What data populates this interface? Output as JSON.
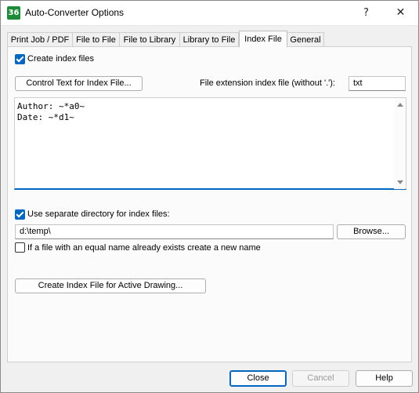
{
  "window": {
    "title": "Auto-Converter Options",
    "app_icon_text": "36",
    "help_glyph": "?",
    "close_glyph": "✕"
  },
  "tabs": [
    {
      "label": "Print Job / PDF",
      "active": false
    },
    {
      "label": "File to File",
      "active": false
    },
    {
      "label": "File to Library",
      "active": false
    },
    {
      "label": "Library to File",
      "active": false
    },
    {
      "label": "Index File",
      "active": true
    },
    {
      "label": "General",
      "active": false
    }
  ],
  "index_file": {
    "create_index_files": {
      "label": "Create index files",
      "checked": true
    },
    "control_text_button": "Control Text for Index File...",
    "extension_label": "File extension index file (without '.'):",
    "extension_value": "txt",
    "index_text": "Author: ~*a0~\nDate: ~*d1~",
    "use_separate_dir": {
      "label": "Use separate directory for index files:",
      "checked": true
    },
    "directory_value": "d:\\temp\\",
    "browse_button": "Browse...",
    "new_name_option": {
      "label": "If a file with an equal name already exists create a new name",
      "checked": false
    },
    "create_active_button": "Create Index File for Active Drawing..."
  },
  "footer": {
    "close": "Close",
    "cancel": "Cancel",
    "help": "Help"
  }
}
